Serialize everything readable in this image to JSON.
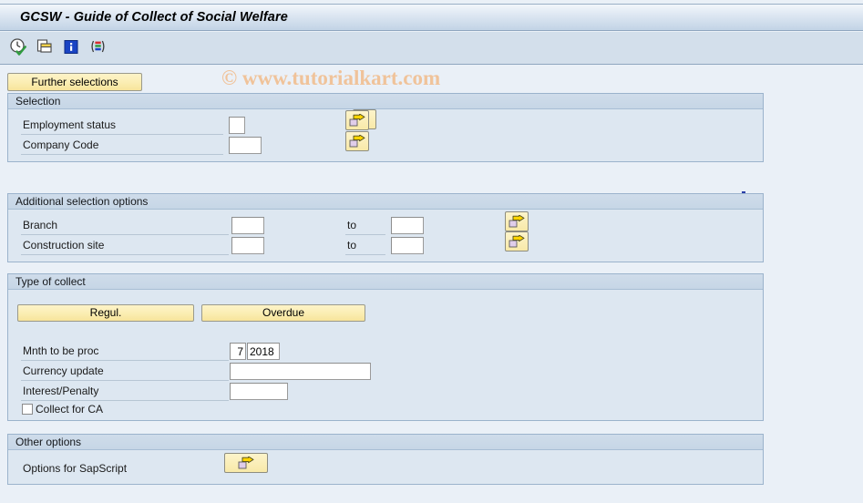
{
  "window": {
    "title": "GCSW - Guide of Collect of Social Welfare",
    "watermark": "© www.tutorialkart.com"
  },
  "toolbar": {
    "icons": [
      {
        "name": "execute-clock-icon",
        "label": "Execute"
      },
      {
        "name": "copy-variant-icon",
        "label": "Get Variant"
      },
      {
        "name": "info-icon",
        "label": "Information"
      },
      {
        "name": "color-bars-icon",
        "label": "Display Columns"
      }
    ]
  },
  "further_selections": {
    "label": "Further selections"
  },
  "groups": {
    "selection": {
      "title": "Selection",
      "fields": [
        {
          "label": "Employment status",
          "value": "",
          "arrow": "matchcode-arrow-icon"
        },
        {
          "label": "Company Code",
          "value": "",
          "arrow": "matchcode-arrow-icon"
        }
      ]
    },
    "additional": {
      "title": "Additional selection options",
      "to_label": "to",
      "fields": [
        {
          "label": "Branch",
          "from": "",
          "to": "",
          "arrow": "matchcode-arrow-icon"
        },
        {
          "label": "Construction site",
          "from": "",
          "to": "",
          "arrow": "matchcode-arrow-icon"
        }
      ]
    },
    "type_of_collect": {
      "title": "Type of collect",
      "buttons": [
        {
          "label": "Regul."
        },
        {
          "label": "Overdue"
        }
      ],
      "month_label": "Mnth to be proc",
      "month_value": "7",
      "year_value": "2018",
      "currency_label": "Currency update",
      "currency_value": "",
      "interest_label": "Interest/Penalty",
      "interest_value": "",
      "checkbox_label": "Collect for CA",
      "checkbox_checked": false
    },
    "other": {
      "title": "Other options",
      "sapscript_label": "Options for SapScript",
      "sapscript_arrow": "matchcode-arrow-icon"
    }
  },
  "colors": {
    "window_bg": "#eaf0f7",
    "group_bg": "#dde7f1",
    "group_header": "#c6d6e6",
    "button_yellow": "#fbeeb4",
    "watermark": "#f0c39a",
    "border_blue": "#9bb3cc"
  }
}
